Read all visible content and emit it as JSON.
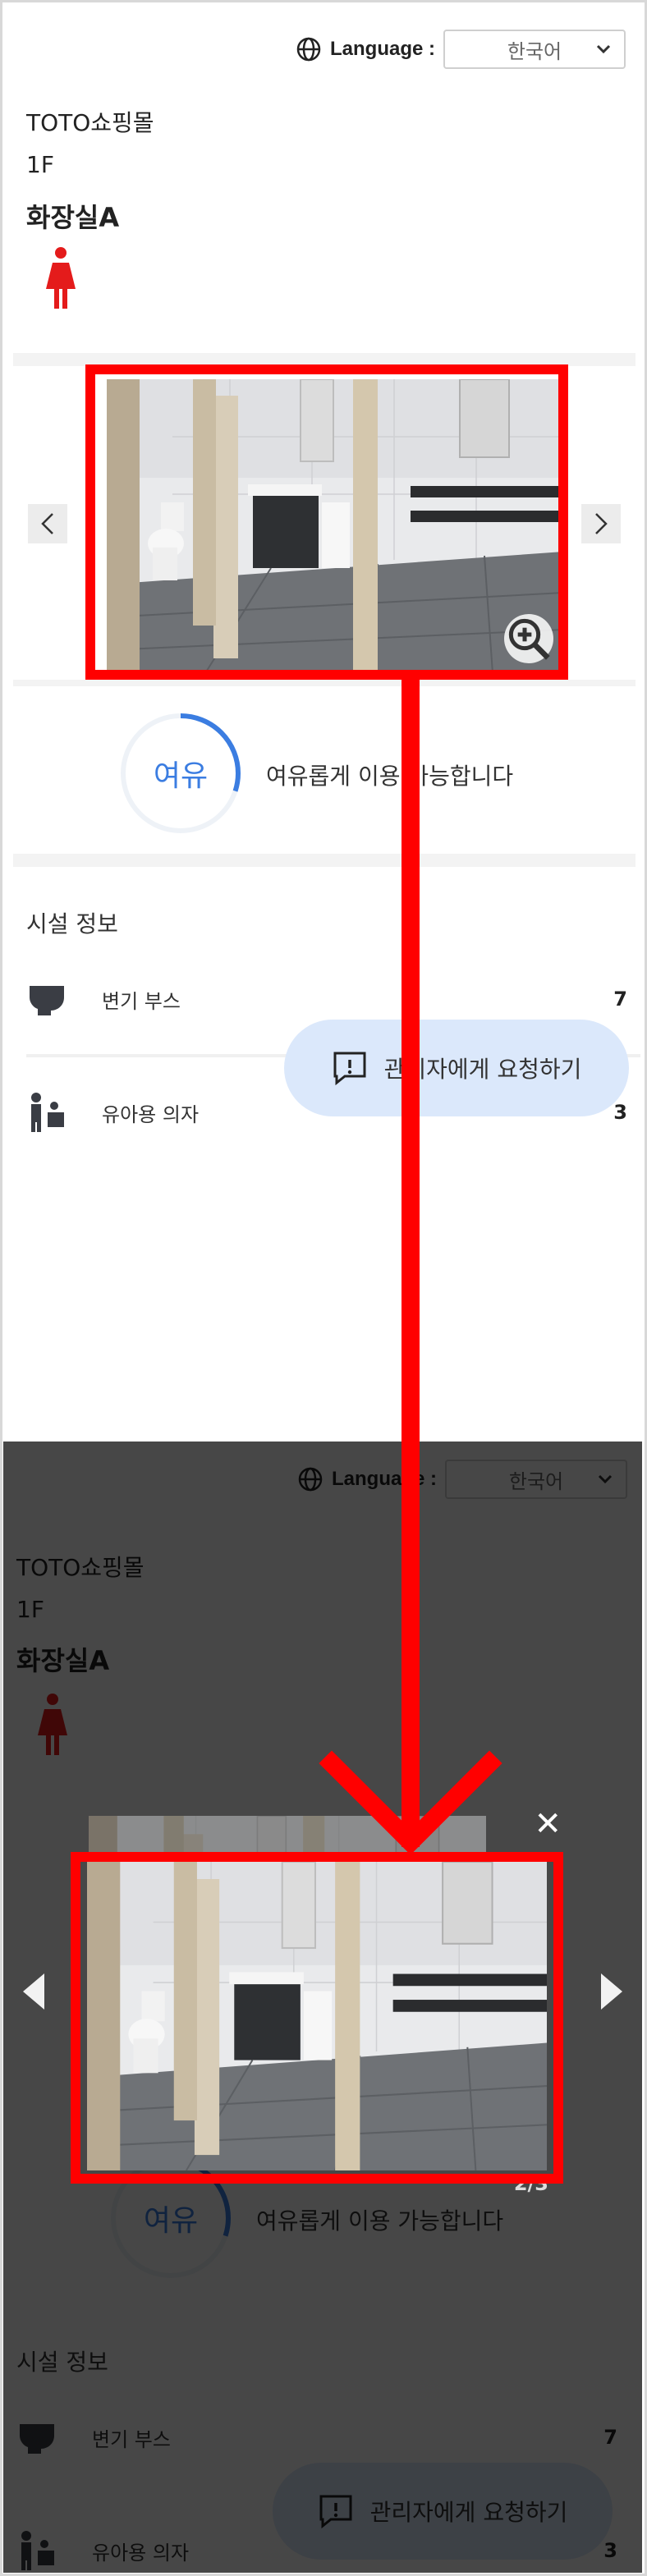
{
  "header": {
    "language_label": "Language :",
    "language_value": "한국어"
  },
  "location": {
    "mall": "TOTO쇼핑몰",
    "floor": "1F",
    "room": "화장실A"
  },
  "status": {
    "badge": "여유",
    "description": "여유롭게 이용 가능합니다",
    "level_percent": 30
  },
  "facilities": {
    "title": "시설 정보",
    "items": [
      {
        "name": "변기 부스",
        "count": "7",
        "icon": "toilet-booth-icon"
      },
      {
        "name": "유아용 의자",
        "count": "3",
        "icon": "baby-chair-icon"
      }
    ]
  },
  "request": {
    "label": "관리자에게 요청하기"
  },
  "modal": {
    "pager": "2/3",
    "close": "✕"
  },
  "colors": {
    "accent": "#3b7de1",
    "female": "#e41b1b",
    "annotation": "#ff0000",
    "request_bg": "#dbe8fb"
  }
}
